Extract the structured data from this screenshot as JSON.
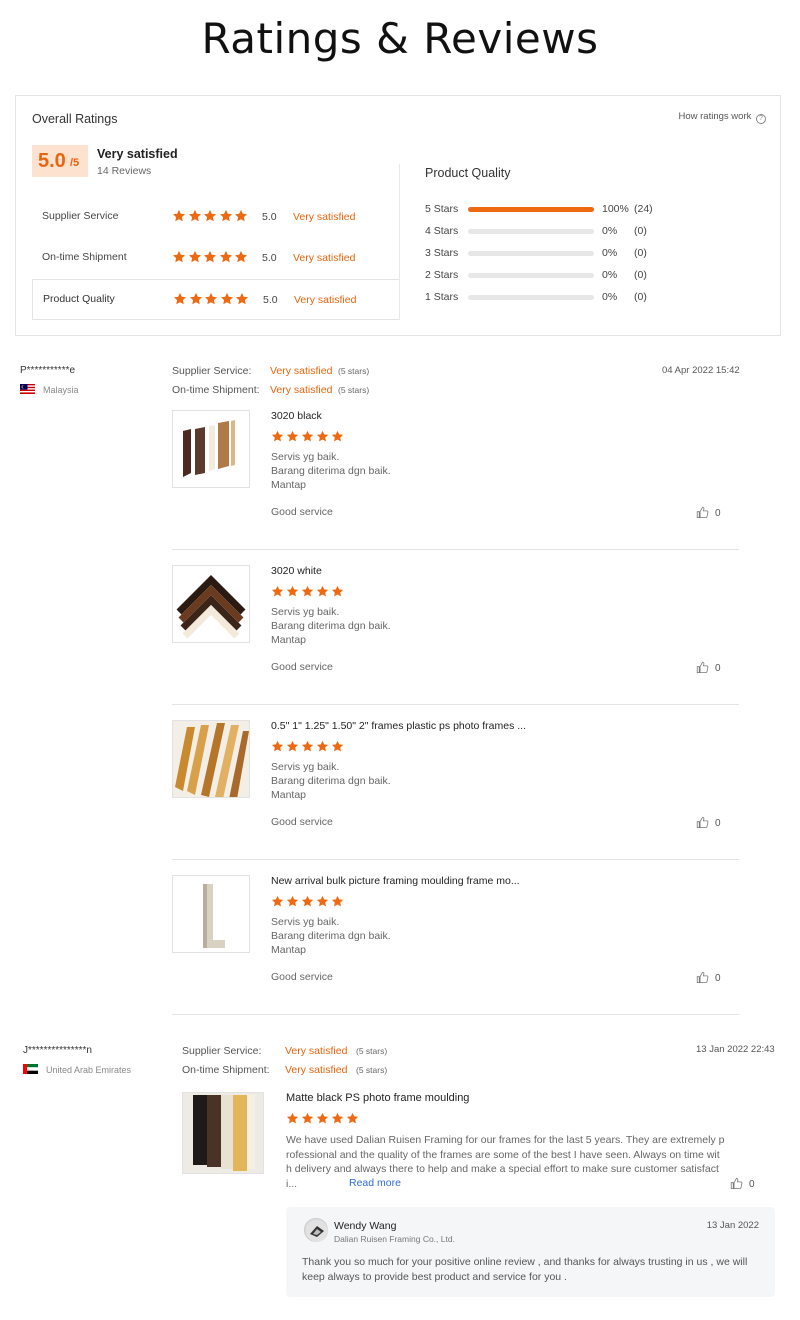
{
  "page_title": "Ratings & Reviews",
  "colors": {
    "accent": "#ee6a12",
    "star": "#ee6a12",
    "link": "#2f6bd8"
  },
  "overall": {
    "title": "Overall Ratings",
    "how_link": "How ratings work",
    "score": "5.0",
    "score_suffix": "/5",
    "satisfaction": "Very satisfied",
    "review_count": "14 Reviews",
    "categories": [
      {
        "label": "Supplier Service",
        "stars": 5,
        "score": "5.0",
        "text": "Very satisfied"
      },
      {
        "label": "On-time Shipment",
        "stars": 5,
        "score": "5.0",
        "text": "Very satisfied"
      },
      {
        "label": "Product Quality",
        "stars": 5,
        "score": "5.0",
        "text": "Very satisfied"
      }
    ]
  },
  "distribution": {
    "title": "Product Quality",
    "rows": [
      {
        "label": "5  Stars",
        "fraction": 1.0,
        "pct": "100%",
        "count": "(24)"
      },
      {
        "label": "4  Stars",
        "fraction": 0.0,
        "pct": "0%",
        "count": "(0)"
      },
      {
        "label": "3  Stars",
        "fraction": 0.0,
        "pct": "0%",
        "count": "(0)"
      },
      {
        "label": "2  Stars",
        "fraction": 0.0,
        "pct": "0%",
        "count": "(0)"
      },
      {
        "label": "1  Stars",
        "fraction": 0.0,
        "pct": "0%",
        "count": "(0)"
      }
    ]
  },
  "reviews": [
    {
      "user": "P***********e",
      "country": "Malaysia",
      "flag": "malaysia-flag",
      "date": "04 Apr 2022 15:42",
      "supplier_label": "Supplier Service:",
      "supplier_value": "Very satisfied",
      "supplier_stars": "(5 stars)",
      "shipment_label": "On-time Shipment:",
      "shipment_value": "Very satisfied",
      "shipment_stars": "(5 stars)",
      "items": [
        {
          "name": "3020 black",
          "stars": 5,
          "lines": [
            "Servis yg baik.",
            "Barang diterima dgn baik.",
            "Mantap"
          ],
          "tag": "Good service",
          "likes": "0"
        },
        {
          "name": "3020 white",
          "stars": 5,
          "lines": [
            "Servis yg baik.",
            "Barang diterima dgn baik.",
            "Mantap"
          ],
          "tag": "Good service",
          "likes": "0"
        },
        {
          "name": "0.5\" 1\" 1.25\" 1.50\" 2\" frames plastic ps photo frames ...",
          "stars": 5,
          "lines": [
            "Servis yg baik.",
            "Barang diterima dgn baik.",
            "Mantap"
          ],
          "tag": "Good service",
          "likes": "0"
        },
        {
          "name": "New arrival bulk picture framing moulding frame mo...",
          "stars": 5,
          "lines": [
            "Servis yg baik.",
            "Barang diterima dgn baik.",
            "Mantap"
          ],
          "tag": "Good service",
          "likes": "0"
        }
      ]
    },
    {
      "user": "J***************n",
      "country": "United Arab Emirates",
      "flag": "uae-flag",
      "date": "13 Jan 2022 22:43",
      "supplier_label": "Supplier Service:",
      "supplier_value": "Very satisfied",
      "supplier_stars": "(5 stars)",
      "shipment_label": "On-time Shipment:",
      "shipment_value": "Very satisfied",
      "shipment_stars": "(5 stars)",
      "item": {
        "name": "Matte black PS photo frame moulding",
        "stars": 5,
        "lines": [
          "We have used Dalian Ruisen Framing for our frames for the last 5 years. They are extremely p",
          "rofessional and the quality of the frames are some of the best I have seen. Always on time wit",
          "h delivery and always there to help and make a special effort to make sure customer satisfact",
          "i..."
        ],
        "read_more": "Read more",
        "likes": "0"
      },
      "reply": {
        "name": "Wendy Wang",
        "company": "Dalian Ruisen Framing Co., Ltd.",
        "date": "13 Jan 2022",
        "text": "Thank you so much for your positive online review , and thanks for always trusting in us , we will keep always to provide best product and service for you ."
      }
    }
  ]
}
